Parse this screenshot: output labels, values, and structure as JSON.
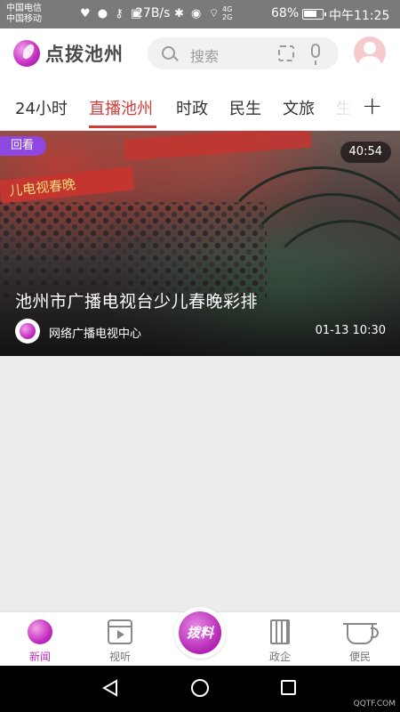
{
  "status_bar": {
    "carrier_1": "中国电信",
    "carrier_2": "中国移动",
    "net_speed": "27B/s",
    "net_label_1": "4G",
    "net_label_2": "2G",
    "battery": "68%",
    "time": "中午11:25"
  },
  "header": {
    "app_name": "点拨池州",
    "search_placeholder": "搜索"
  },
  "tabs": [
    {
      "label": "24小时",
      "active": false
    },
    {
      "label": "直播池州",
      "active": true
    },
    {
      "label": "时政",
      "active": false
    },
    {
      "label": "民生",
      "active": false
    },
    {
      "label": "文旅",
      "active": false
    },
    {
      "label": "生",
      "active": false
    }
  ],
  "tab_add_label": "+",
  "video_card": {
    "badge": "回看",
    "duration": "40:54",
    "title": "池州市广播电视台少儿春晚彩排",
    "source": "网络广播电视中心",
    "time": "01-13 10:30",
    "banner_text": "儿电视春晚"
  },
  "bottom_nav": {
    "items": [
      {
        "label": "新闻",
        "icon": "news-icon",
        "active": true
      },
      {
        "label": "视听",
        "icon": "video-icon",
        "active": false
      },
      {
        "label": "政企",
        "icon": "government-icon",
        "active": false
      },
      {
        "label": "便民",
        "icon": "coffee-icon",
        "active": false
      }
    ],
    "center_label": "拨料"
  },
  "watermark": "QQTF.COM",
  "colors": {
    "accent_red": "#d43c3c",
    "brand_purple": "#c42cc0",
    "badge_purple": "#8e47e0"
  }
}
